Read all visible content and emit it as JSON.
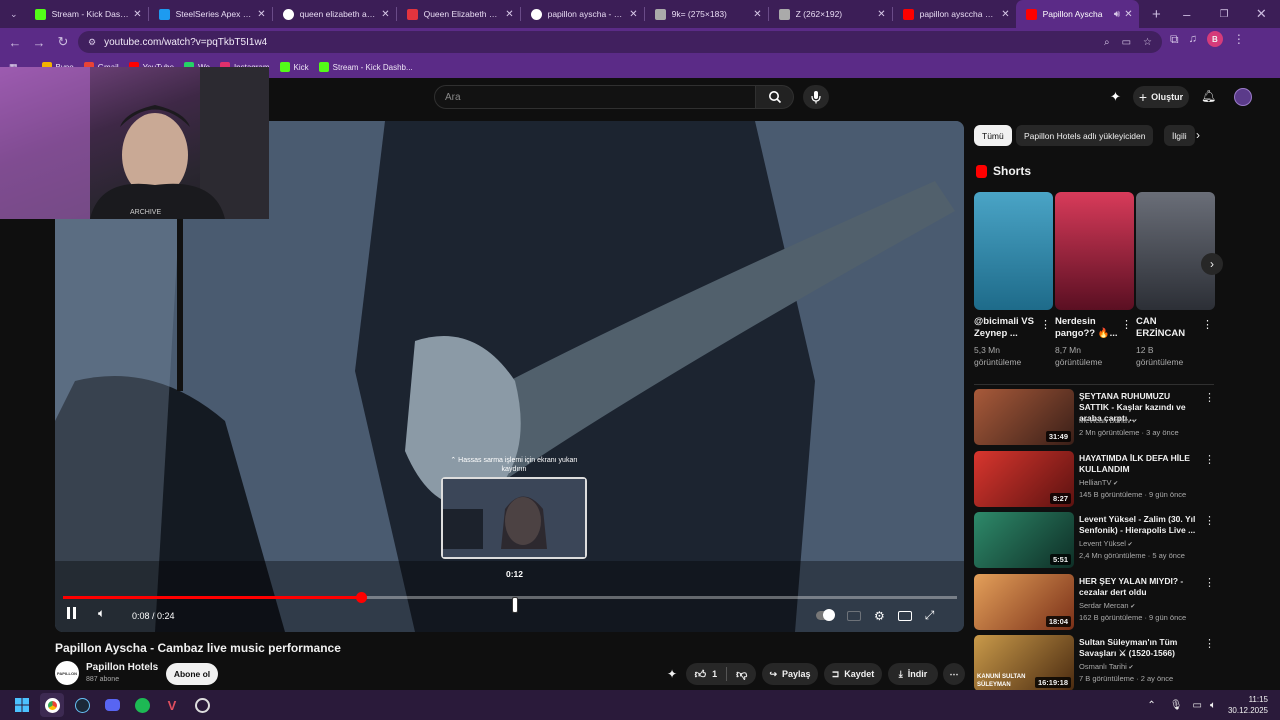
{
  "browser": {
    "tabs": [
      {
        "label": "Stream - Kick Dashbo",
        "icon": "kick-icon",
        "color": "#53fc18"
      },
      {
        "label": "SteelSeries Apex 5 Hy",
        "icon": "check-icon",
        "color": "#1d9bf0"
      },
      {
        "label": "queen elizabeth antal",
        "icon": "google-icon",
        "color": "#ffffff"
      },
      {
        "label": "Queen Elizabeth Elite",
        "icon": "z-icon",
        "color": "#e3343e"
      },
      {
        "label": "papillon ayscha - Goo",
        "icon": "google-icon",
        "color": "#ffffff"
      },
      {
        "label": "9k= (275×183)",
        "icon": "globe-icon",
        "color": "#aaaaaa"
      },
      {
        "label": "Z (262×192)",
        "icon": "globe-icon",
        "color": "#aaaaaa"
      },
      {
        "label": "papillon aysccha song",
        "icon": "youtube-icon",
        "color": "#ff0000"
      },
      {
        "label": "Papillon Ayscha",
        "icon": "youtube-icon",
        "color": "#ff0000"
      }
    ],
    "url": "youtube.com/watch?v=pqTkbT5I1w4",
    "bookmarks": [
      {
        "label": "Bypo",
        "color": "#f4b400"
      },
      {
        "label": "Gmail",
        "color": "#ea4335"
      },
      {
        "label": "YouTube",
        "color": "#ff0000"
      },
      {
        "label": "Wo",
        "color": "#25d366"
      },
      {
        "label": "Instagram",
        "color": "#e1306c"
      },
      {
        "label": "Kick",
        "color": "#53fc18"
      },
      {
        "label": "Stream - Kick Dashb...",
        "color": "#53fc18"
      }
    ],
    "profile_initial": "B"
  },
  "youtube": {
    "search_placeholder": "Ara",
    "create_label": "Oluştur",
    "video": {
      "title": "Papillon Ayscha - Cambaz live music performance",
      "time": "0:08 / 0:24",
      "hover_time": "0:12",
      "progress": 0.333,
      "hint": "⌃ Hassas sarma işlemi için ekranı yukarı kaydırın",
      "cam_label": "ARCHIVE"
    },
    "channel": {
      "name": "Papillon Hotels",
      "subs": "887 abone",
      "avatar_text": "PAPILLON",
      "subscribe": "Abone ol"
    },
    "actions": {
      "like_count": "1",
      "share": "Paylaş",
      "save": "Kaydet",
      "download": "İndir"
    },
    "chips": [
      "Tümü",
      "Papillon Hotels adlı yükleyiciden",
      "İlgili"
    ],
    "shorts_title": "Shorts",
    "shorts": [
      {
        "title": "@bicimali VS Zeynep ...",
        "views": "5,3 Mn görüntüleme",
        "c1": "#4aa4c6",
        "c2": "#1e6b8a"
      },
      {
        "title": "Nerdesin pango?? 🔥...",
        "views": "8,7 Mn görüntüleme",
        "c1": "#d83b5a",
        "c2": "#5a0f22"
      },
      {
        "title": "CAN ERZİNCAN",
        "views": "12 B görüntüleme",
        "c1": "#6a6e78",
        "c2": "#2c2f36"
      }
    ],
    "recommended": [
      {
        "title": "ŞEYTANA RUHUMUZU SATTIK - Kaşlar kazındı ve araba çarptı ...",
        "channel": "Mevtcan Bahav",
        "views": "2 Mn görüntüleme · 3 ay önce",
        "duration": "31:49",
        "c1": "#a85a3a",
        "c2": "#3a1f18"
      },
      {
        "title": "HAYATIMDA İLK DEFA HİLE KULLANDIM",
        "channel": "HellianTV",
        "views": "145 B görüntüleme · 9 gün önce",
        "duration": "8:27",
        "c1": "#d8362e",
        "c2": "#5c1210"
      },
      {
        "title": "Levent Yüksel - Zalim (30. Yıl Senfonik) - Hierapolis Live ...",
        "channel": "Levent Yüksel",
        "views": "2,4 Mn görüntüleme · 5 ay önce",
        "duration": "5:51",
        "c1": "#2e8a6a",
        "c2": "#0e2e26"
      },
      {
        "title": "HER ŞEY YALAN MIYDI? - cezalar dert oldu",
        "channel": "Serdar Mercan",
        "views": "162 B görüntüleme · 9 gün önce",
        "duration": "18:04",
        "c1": "#e4a05a",
        "c2": "#7a3018"
      },
      {
        "title": "Sultan Süleyman'ın Tüm Savaşları ⚔ (1520-1566)",
        "channel": "Osmanlı Tarihi",
        "views": "7 B görüntüleme · 2 ay önce",
        "duration": "16:19:18",
        "c1": "#c99a4a",
        "c2": "#4a2a10",
        "overlay": "KANUNİ SULTAN SÜLEYMAN"
      }
    ]
  },
  "taskbar": {
    "time": "11:15",
    "date": "30.12.2025"
  }
}
